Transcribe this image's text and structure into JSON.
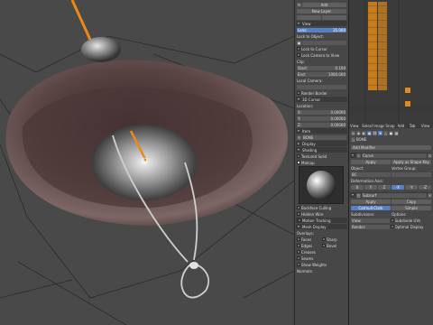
{
  "view_panel": {
    "toolbar": {
      "add_label": "Add",
      "new_layer_label": "New Layer"
    },
    "view": {
      "header": "View",
      "lens_label": "Lens:",
      "lens_value": "35.000",
      "lock_to_object": "Lock to Object:",
      "lock_to_cursor": "Lock to Cursor",
      "lock_camera": "Lock Camera to View",
      "clip_header": "Clip:",
      "start_label": "Start:",
      "start_value": "0.100",
      "end_label": "End:",
      "end_value": "1000.000",
      "local_camera": "Local Camera:",
      "render_border": "Render Border"
    },
    "cursor": {
      "header": "3D Cursor",
      "location_label": "Location:",
      "x_label": "X:",
      "x_value": "0.00000",
      "y_label": "Y:",
      "y_value": "0.00000",
      "z_label": "Z:",
      "z_value": "0.00000"
    },
    "item": {
      "header": "Item",
      "name": "BONE"
    },
    "display": {
      "header": "Display"
    },
    "shading": {
      "header": "Shading",
      "textured_solid": "Textured Solid",
      "matcap": "Matcap"
    },
    "after_matcap": {
      "backface_culling": "Backface Culling",
      "hidden_wire": "Hidden Wire"
    },
    "motion_tracking": {
      "header": "Motion Tracking"
    },
    "mesh_display": {
      "header": "Mesh Display",
      "overlays_label": "Overlays:",
      "faces": "Faces",
      "sharp": "Sharp",
      "edges": "Edges",
      "bevel": "Bevel",
      "creases": "Creases",
      "seams": "Seams",
      "show_weights": "Show Weights",
      "normals_label": "Normals:"
    }
  },
  "properties": {
    "tabs": [
      "View",
      "Select",
      "Image",
      "Snap",
      "Add",
      "Tab",
      "View"
    ],
    "object_name": "BONE",
    "modifier_header": "Add Modifier",
    "curve_modifier": {
      "name": "Curve",
      "apply": "Apply",
      "apply_shape": "Apply as Shape Key",
      "object_label": "Object:",
      "object_value": "BC",
      "vertex_group": "Vertex Group:",
      "deformation_axis": "Deformation Axis:",
      "axes": [
        "X",
        "Y",
        "Z",
        "-X",
        "-Y",
        "-Z"
      ]
    },
    "subsurf_modifier": {
      "name": "Subsurf",
      "apply": "Apply",
      "copy": "Copy",
      "catmull": "Catmull-Clark",
      "simple": "Simple",
      "subdivisions_label": "Subdivisions:",
      "view_label": "View:",
      "render_label": "Render:",
      "options_label": "Options:",
      "subdivide_uvs": "Subdivide UVs",
      "optimal_display": "Optimal Display"
    }
  }
}
